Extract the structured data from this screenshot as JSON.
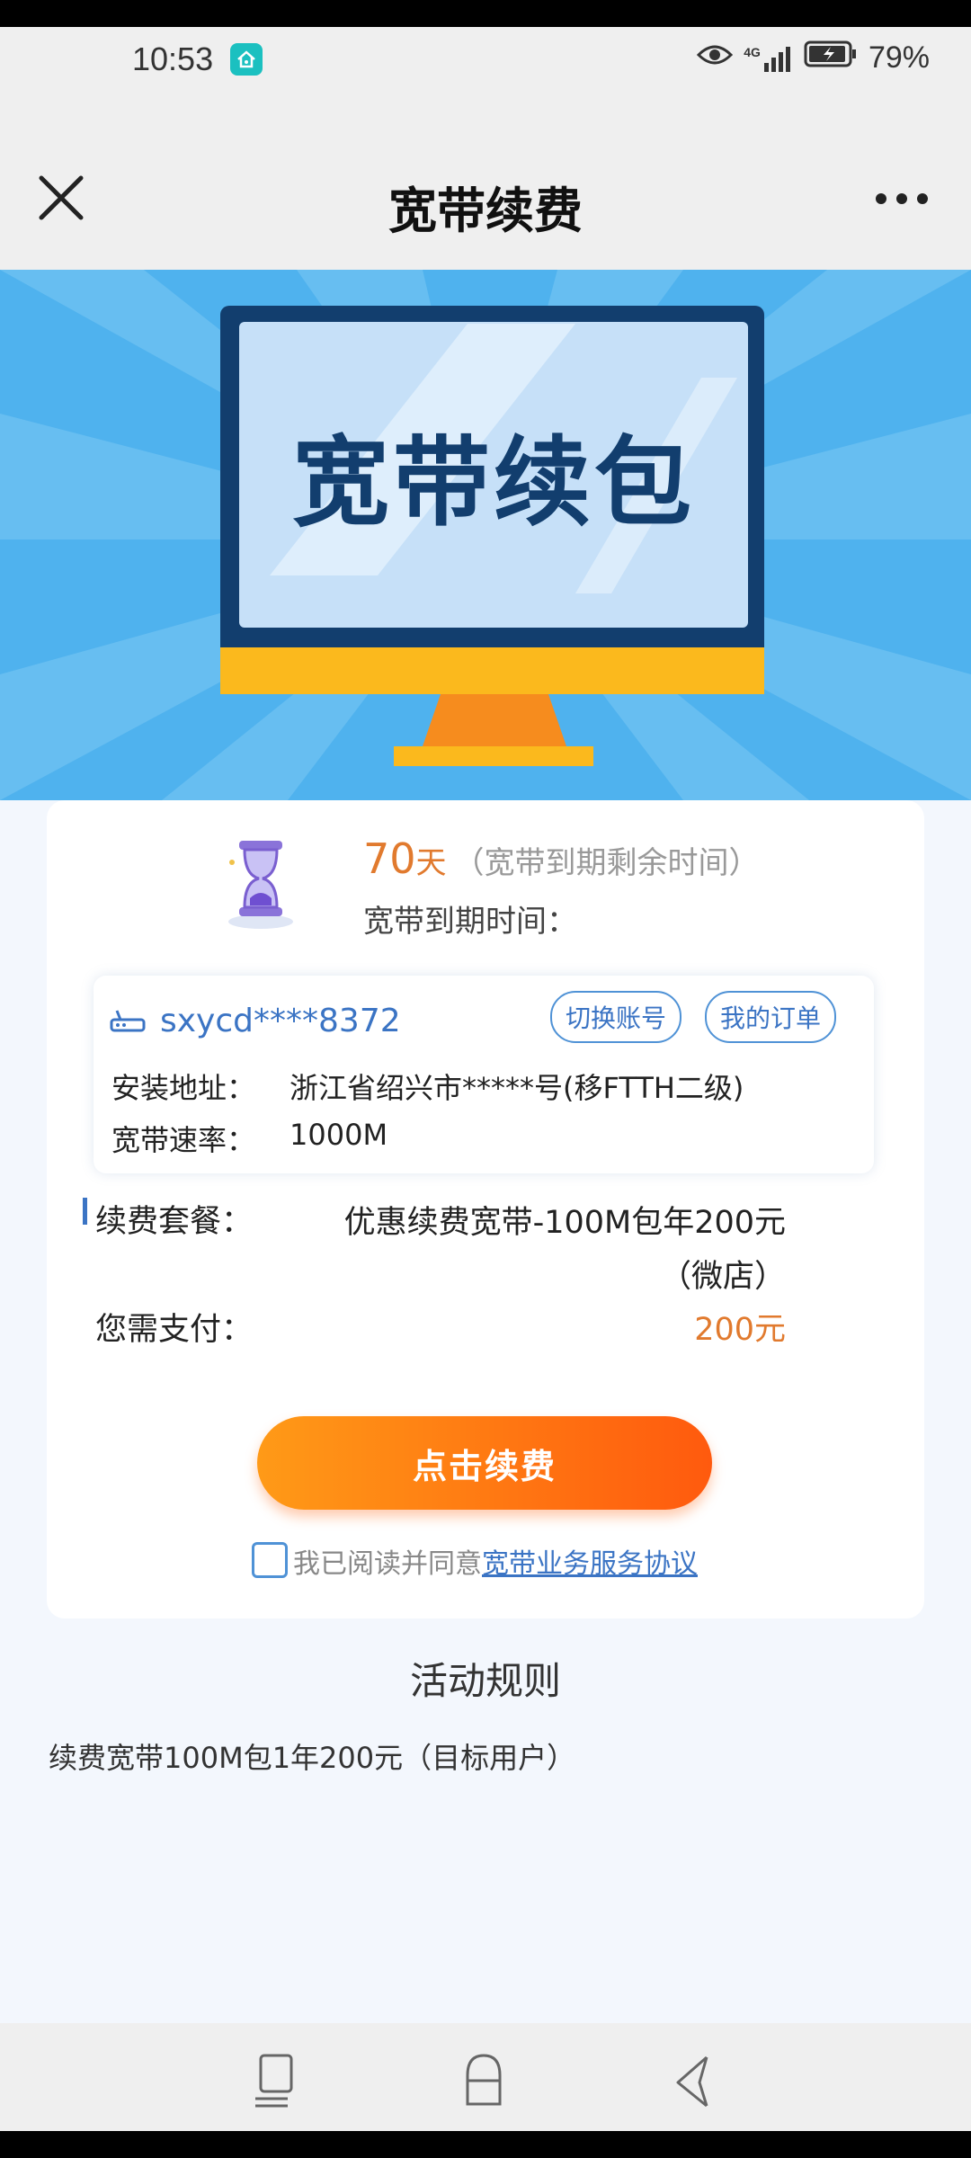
{
  "status_bar": {
    "time": "10:53",
    "network": "4G",
    "battery": "79%"
  },
  "header": {
    "title": "宽带续费"
  },
  "banner": {
    "text": "宽带续包"
  },
  "expiry": {
    "days": "70",
    "days_unit": "天",
    "days_note": "（宽带到期剩余时间）",
    "expire_label": "宽带到期时间："
  },
  "account": {
    "id": "sxycd****8372",
    "switch_label": "切换账号",
    "orders_label": "我的订单",
    "address_label": "安装地址：",
    "address_value": "浙江省绍兴市*****号(移FTTH二级)",
    "speed_label": "宽带速率：",
    "speed_value": "1000M"
  },
  "package": {
    "label": "续费套餐：",
    "value_line1": "优惠续费宽带-100M包年200元",
    "value_line2": "（微店）"
  },
  "payment": {
    "label": "您需支付：",
    "value": "200元"
  },
  "renew_button": "点击续费",
  "agreement": {
    "prefix": "我已阅读并同意",
    "link": "宽带业务服务协议"
  },
  "rules": {
    "title": "活动规则",
    "text": "续费宽带100M包1年200元（目标用户）"
  },
  "colors": {
    "accent_blue": "#3b74c4",
    "accent_orange": "#e17a2e",
    "banner_blue": "#4fb2ee"
  }
}
